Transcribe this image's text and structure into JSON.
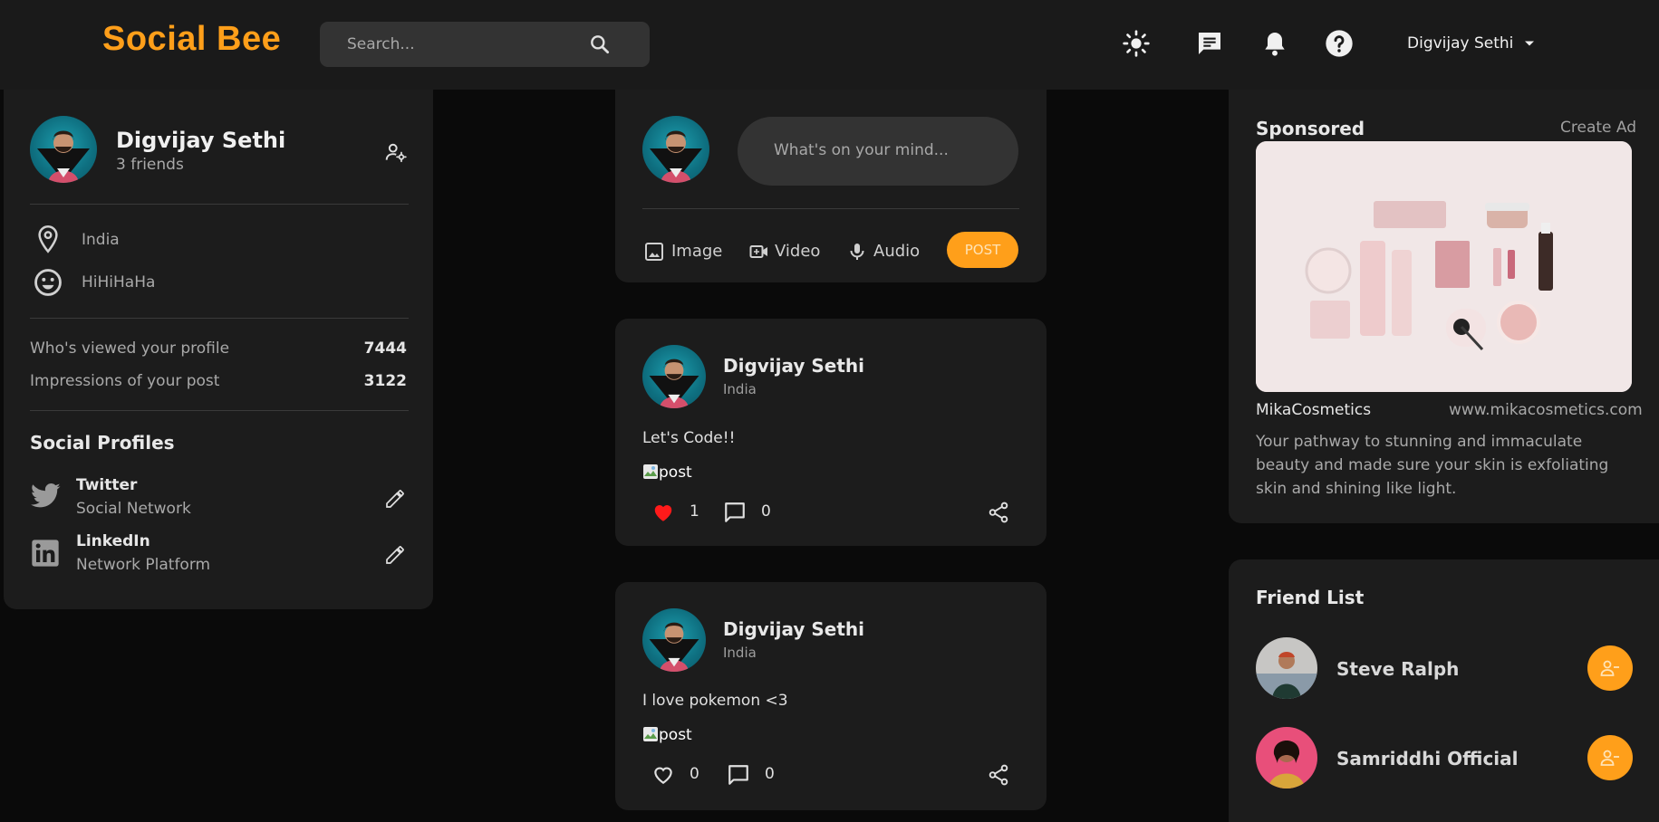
{
  "brand": {
    "name": "Social Bee",
    "accent": "#ff9f1a"
  },
  "search": {
    "placeholder": "Search..."
  },
  "nav": {
    "icons": [
      "theme-light-icon",
      "message-icon",
      "notification-bell-icon",
      "help-icon"
    ],
    "user_name": "Digvijay Sethi"
  },
  "profile": {
    "name": "Digvijay Sethi",
    "friends": "3 friends",
    "location": "India",
    "occupation": "HiHiHaHa",
    "viewed_label": "Who's viewed your profile",
    "viewed_value": "7444",
    "impressions_label": "Impressions of your post",
    "impressions_value": "3122",
    "social_title": "Social Profiles",
    "social": [
      {
        "name": "Twitter",
        "sub": "Social Network",
        "icon": "twitter-icon"
      },
      {
        "name": "LinkedIn",
        "sub": "Network Platform",
        "icon": "linkedin-icon"
      }
    ]
  },
  "composer": {
    "placeholder": "What's on your mind...",
    "actions": [
      "Image",
      "Video",
      "Audio"
    ],
    "post_label": "POST"
  },
  "posts": [
    {
      "author": "Digvijay Sethi",
      "location": "India",
      "text": "Let's Code!!",
      "image_alt": "post",
      "likes": "1",
      "liked": true,
      "comments": "0"
    },
    {
      "author": "Digvijay Sethi",
      "location": "India",
      "text": "I love pokemon <3",
      "image_alt": "post",
      "likes": "0",
      "liked": false,
      "comments": "0"
    }
  ],
  "sponsored": {
    "title": "Sponsored",
    "create": "Create Ad",
    "brand": "MikaCosmetics",
    "url": "www.mikacosmetics.com",
    "description": "Your pathway to stunning and immaculate beauty and made sure your skin is exfoliating skin and shining like light."
  },
  "friend_list": {
    "title": "Friend List",
    "friends": [
      {
        "name": "Steve Ralph"
      },
      {
        "name": "Samriddhi Official"
      }
    ]
  }
}
